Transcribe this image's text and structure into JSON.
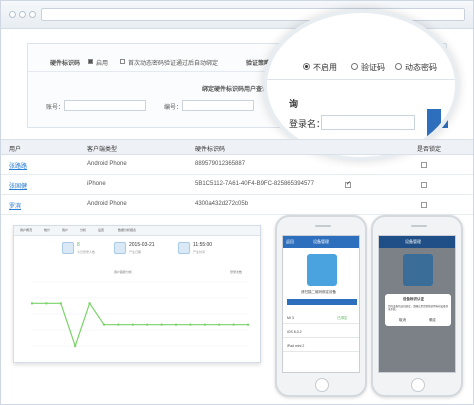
{
  "filter": {
    "hw_label": "硬件标识码",
    "enable_label": "启用",
    "first_auth_label": "首次动态密码验证通过后自动绑定",
    "verify_label": "验证策略",
    "bind_title": "绑定硬件标识码用户查询",
    "account_label": "账号：",
    "number_label": "编号："
  },
  "zoom": {
    "options": [
      "不启用",
      "验证码",
      "动态密码"
    ],
    "selected_index": 0,
    "partial_title": "询",
    "login_label": "登录名："
  },
  "table": {
    "headers": [
      "用户",
      "客户端类型",
      "硬件标识码",
      "是否锁定"
    ],
    "rows": [
      {
        "user": "张路路",
        "type": "Android Phone",
        "hwid": "889579012365887",
        "checked": false,
        "locked": false
      },
      {
        "user": "张国健",
        "type": "iPhone",
        "hwid": "5B1C5112-7A61-40F4-B9FC-825865394577",
        "checked": true,
        "locked": false
      },
      {
        "user": "罗滨",
        "type": "Android Phone",
        "hwid": "4300a432d272c05b",
        "checked": false,
        "locked": false
      }
    ]
  },
  "dashboard": {
    "tabs": [
      "用户概况",
      "统计",
      "用户",
      "分析",
      "设置",
      "数据分析报表"
    ],
    "stats": [
      {
        "value": "8",
        "caption": "今日登录人数"
      },
      {
        "value": "2015-03-21",
        "caption": "产生日期"
      },
      {
        "value": "11:55:00",
        "caption": "产生时间"
      }
    ],
    "chart_title": "用户趋势分析",
    "legend": "登录次数"
  },
  "chart_data": {
    "type": "line",
    "title": "用户趋势分析",
    "series": [
      {
        "name": "登录次数",
        "values": [
          2,
          2,
          2,
          0,
          2,
          1,
          1,
          1,
          1,
          1,
          1,
          1,
          1,
          1,
          1,
          1
        ]
      }
    ],
    "ylim": [
      0,
      3
    ]
  },
  "phone1": {
    "title": "设备管理",
    "back": "返回",
    "hint": "请扫描二维码绑定设备",
    "rows": [
      "MI 3",
      "已绑定",
      "iOS 8.0.2",
      "iPad mini 2"
    ]
  },
  "phone2": {
    "title": "设备管理",
    "dialog_title": "设备标识认证",
    "dialog_text": "您的设备已成功绑定，请确认是否继续使用当前设备登录系统。",
    "cancel": "取消",
    "confirm": "确定"
  },
  "colors": {
    "accent": "#2d6fbd",
    "link": "#2a7dd4",
    "chart_line": "#7bd36a"
  }
}
